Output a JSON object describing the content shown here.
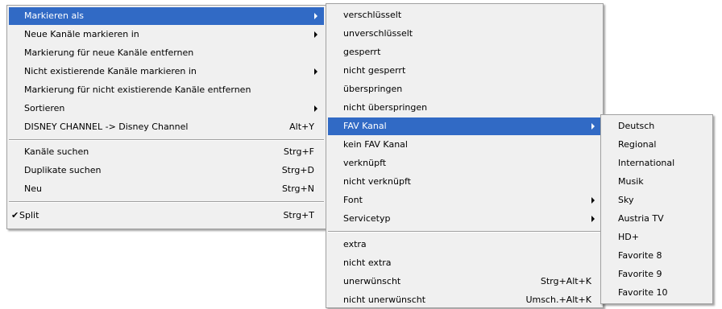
{
  "menu1": {
    "items": [
      {
        "label": "Markieren als",
        "shortcut": "",
        "submenu": true
      },
      {
        "label": "Neue Kanäle markieren in",
        "shortcut": "",
        "submenu": true
      },
      {
        "label": "Markierung für neue Kanäle entfernen",
        "shortcut": "",
        "submenu": false
      },
      {
        "label": "Nicht existierende Kanäle markieren in",
        "shortcut": "",
        "submenu": true
      },
      {
        "label": "Markierung für nicht existierende Kanäle entfernen",
        "shortcut": "",
        "submenu": false
      },
      {
        "label": "Sortieren",
        "shortcut": "",
        "submenu": true
      },
      {
        "label": "DISNEY CHANNEL -> Disney Channel",
        "shortcut": "Alt+Y",
        "submenu": false
      },
      {
        "label": "Kanäle suchen",
        "shortcut": "Strg+F",
        "submenu": false
      },
      {
        "label": "Duplikate suchen",
        "shortcut": "Strg+D",
        "submenu": false
      },
      {
        "label": "Neu",
        "shortcut": "Strg+N",
        "submenu": false
      },
      {
        "label": "Split",
        "shortcut": "Strg+T",
        "submenu": false,
        "checked": true,
        "check_mark": "✔"
      }
    ]
  },
  "menu2": {
    "items": [
      {
        "label": "verschlüsselt",
        "shortcut": ""
      },
      {
        "label": "unverschlüsselt",
        "shortcut": ""
      },
      {
        "label": "gesperrt",
        "shortcut": ""
      },
      {
        "label": "nicht gesperrt",
        "shortcut": ""
      },
      {
        "label": "überspringen",
        "shortcut": ""
      },
      {
        "label": "nicht überspringen",
        "shortcut": ""
      },
      {
        "label": "FAV Kanal",
        "shortcut": "",
        "submenu": true
      },
      {
        "label": "kein FAV Kanal",
        "shortcut": ""
      },
      {
        "label": "verknüpft",
        "shortcut": ""
      },
      {
        "label": "nicht verknüpft",
        "shortcut": ""
      },
      {
        "label": "Font",
        "shortcut": "",
        "submenu": true
      },
      {
        "label": "Servicetyp",
        "shortcut": "",
        "submenu": true
      },
      {
        "label": "extra",
        "shortcut": ""
      },
      {
        "label": "nicht extra",
        "shortcut": ""
      },
      {
        "label": "unerwünscht",
        "shortcut": "Strg+Alt+K"
      },
      {
        "label": "nicht unerwünscht",
        "shortcut": "Umsch.+Alt+K"
      }
    ]
  },
  "menu3": {
    "items": [
      {
        "label": "Deutsch"
      },
      {
        "label": "Regional"
      },
      {
        "label": "International"
      },
      {
        "label": "Musik"
      },
      {
        "label": "Sky"
      },
      {
        "label": "Austria TV"
      },
      {
        "label": "HD+"
      },
      {
        "label": "Favorite 8"
      },
      {
        "label": "Favorite 9"
      },
      {
        "label": "Favorite 10"
      }
    ]
  },
  "colors": {
    "highlight": "#316ac5",
    "menu_bg": "#f0f0f0"
  },
  "icons": {
    "submenu": "submenu-arrow-icon",
    "check": "check-icon"
  }
}
